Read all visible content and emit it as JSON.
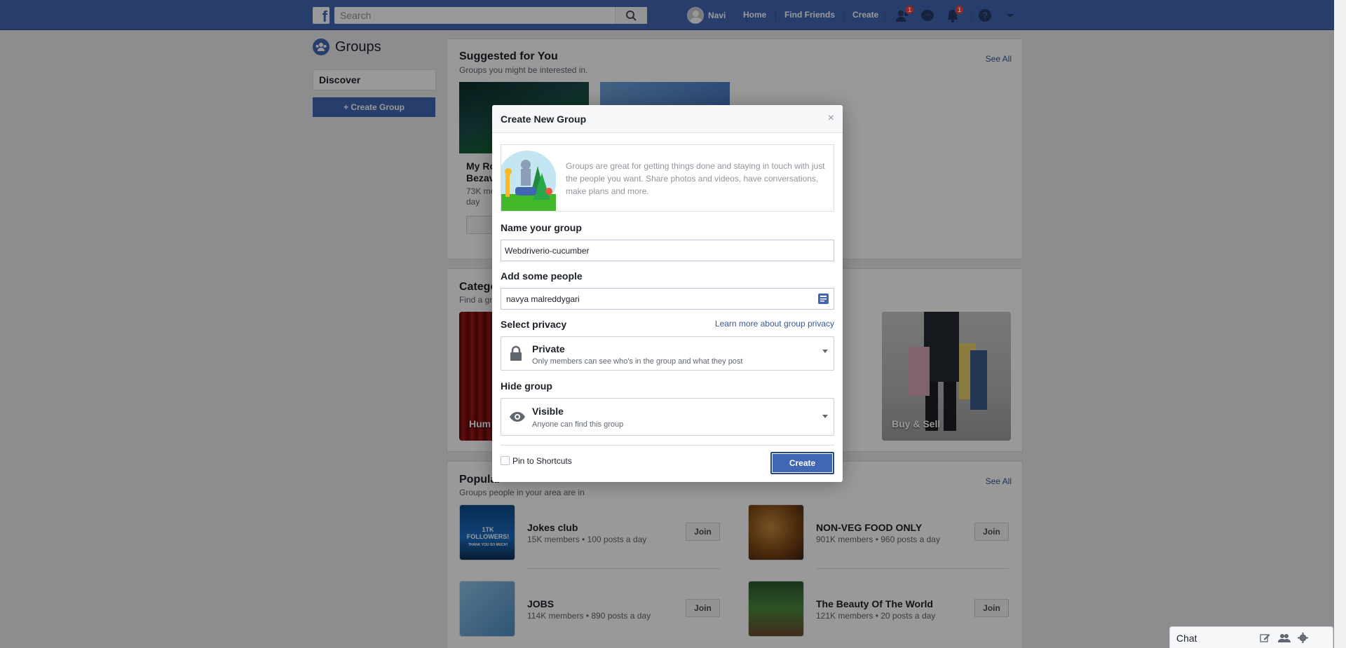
{
  "topbar": {
    "search_placeholder": "Search",
    "profile_name": "Navi",
    "nav": [
      "Home",
      "Find Friends",
      "Create"
    ],
    "friend_requests_badge": "1",
    "notifications_badge": "1"
  },
  "sidebar": {
    "title": "Groups",
    "discover_label": "Discover",
    "create_group_label": "+ Create Group"
  },
  "suggested": {
    "title": "Suggested for You",
    "subtitle": "Groups you might be interested in.",
    "see_all": "See All",
    "card1": {
      "name_line1": "My Ro",
      "name_line2": "Bezav",
      "meta_line1": "73K me",
      "meta_line2": "day"
    }
  },
  "categories": {
    "title": "Catego",
    "subtitle": "Find a gr",
    "tiles": [
      {
        "label": "Hum"
      },
      {
        "label": "Buy & Sell"
      }
    ]
  },
  "popular": {
    "title": "Popular",
    "subtitle": "Groups people in your area are in",
    "see_all": "See All",
    "thumb_text": "1TK FOLLOWERS!",
    "thumb_sub": "THANK YOU SO MUCH!",
    "items": [
      {
        "name": "Jokes club",
        "meta": "15K members • 100 posts a day",
        "join": "Join"
      },
      {
        "name": "NON-VEG FOOD ONLY",
        "meta": "901K members • 960 posts a day",
        "join": "Join"
      },
      {
        "name": "JOBS",
        "meta": "114K members • 890 posts a day",
        "join": "Join"
      },
      {
        "name": "The Beauty Of The World",
        "meta": "121K members • 20 posts a day",
        "join": "Join"
      }
    ]
  },
  "dialog": {
    "title": "Create New Group",
    "close": "×",
    "intro": "Groups are great for getting things done and staying in touch with just the people you want. Share photos and videos, have conversations, make plans and more.",
    "name_label": "Name your group",
    "name_value": "Webdriverio-cucumber",
    "people_label": "Add some people",
    "people_value": "navya malreddygari",
    "privacy_label": "Select privacy",
    "privacy_link": "Learn more about group privacy",
    "privacy_title": "Private",
    "privacy_desc": "Only members can see who's in the group and what they post",
    "hide_label": "Hide group",
    "hide_title": "Visible",
    "hide_desc": "Anyone can find this group",
    "pin_label": "Pin to Shortcuts",
    "pin_checked": false,
    "create_label": "Create"
  },
  "chat": {
    "label": "Chat"
  },
  "colors": {
    "brand": "#4267b2",
    "link": "#365899",
    "badge": "#fa3e3e"
  }
}
